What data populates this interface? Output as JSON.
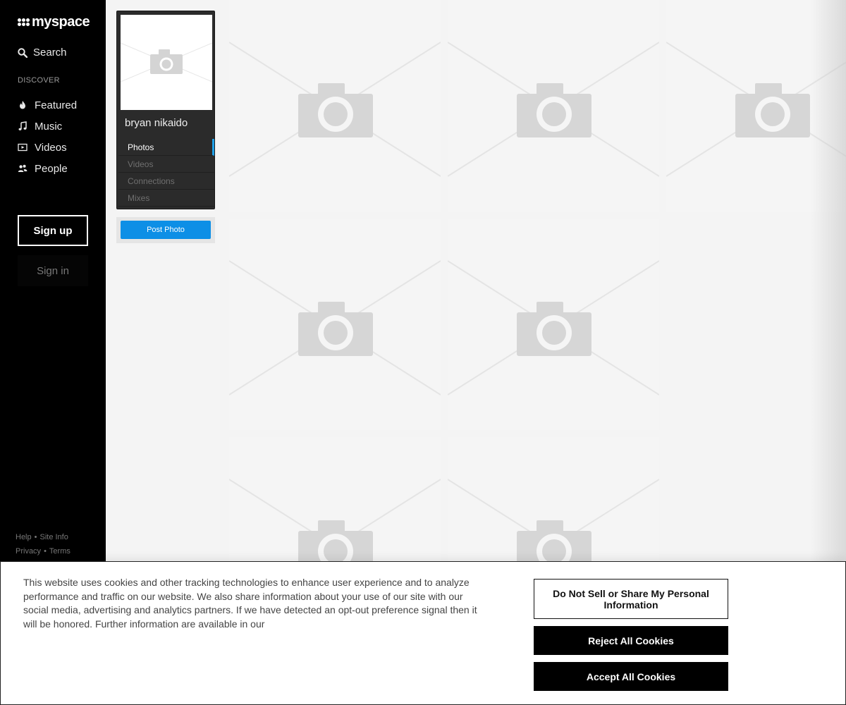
{
  "sidebar": {
    "logo_text": "myspace",
    "search_label": "Search",
    "section_label": "DISCOVER",
    "nav": [
      {
        "label": "Featured",
        "icon": "flame-icon"
      },
      {
        "label": "Music",
        "icon": "music-note-icon"
      },
      {
        "label": "Videos",
        "icon": "video-icon"
      },
      {
        "label": "People",
        "icon": "people-icon"
      }
    ],
    "signup_label": "Sign up",
    "signin_label": "Sign in",
    "footer": {
      "help": "Help",
      "site_info": "Site Info",
      "privacy": "Privacy",
      "terms": "Terms"
    }
  },
  "profile": {
    "name": "bryan nikaido",
    "menu": [
      "Photos",
      "Videos",
      "Connections",
      "Mixes"
    ],
    "active_menu": "Photos",
    "post_photo_label": "Post Photo"
  },
  "grid": {
    "placeholder_icon": "camera-icon",
    "tile_count": 8
  },
  "cookie_banner": {
    "text": "This website uses cookies and other tracking technologies to enhance user experience and to analyze performance and traffic on our website. We also share information about your use of our site with our social media, advertising and analytics partners. If we have detected an opt-out preference signal then it will be honored. Further information are available in our",
    "do_not_sell_label": "Do Not Sell or Share My Personal Information",
    "reject_label": "Reject All Cookies",
    "accept_label": "Accept All Cookies"
  },
  "colors": {
    "sidebar_bg": "#000000",
    "accent_blue": "#0d8fe6",
    "active_indicator": "#1ea0e8"
  }
}
